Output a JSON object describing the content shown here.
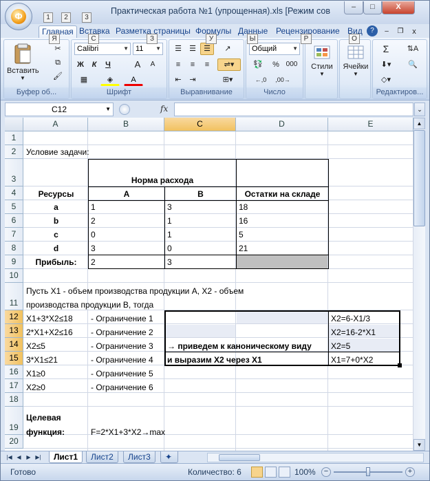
{
  "title_bar": {
    "title": "Практическая работа №1 (упрощенная).xls  [Режим сов",
    "office_key": "Ф",
    "qat_keys": [
      "1",
      "2",
      "3"
    ],
    "min_label": "–",
    "max_label": "□",
    "close_label": "X"
  },
  "ribbon_tabs": [
    {
      "label": "Главная",
      "key": "Я"
    },
    {
      "label": "Вставка",
      "key": "С"
    },
    {
      "label": "Разметка страницы",
      "key": "З"
    },
    {
      "label": "Формулы",
      "key": "У"
    },
    {
      "label": "Данные",
      "key": "Ы"
    },
    {
      "label": "Рецензирование",
      "key": "Р"
    },
    {
      "label": "Вид",
      "key": "О"
    }
  ],
  "ribbon": {
    "clipboard": {
      "paste_label": "Вставить",
      "group_label": "Буфер об..."
    },
    "font": {
      "name": "Calibri",
      "size": "11",
      "group_label": "Шрифт",
      "bold": "Ж",
      "italic": "К",
      "underline": "Ч",
      "grow": "A",
      "shrink": "A"
    },
    "alignment": {
      "group_label": "Выравнивание"
    },
    "number": {
      "format": "Общий",
      "percent": "%",
      "thousands": "000",
      "group_label": "Число"
    },
    "styles": {
      "label": "Стили"
    },
    "cells": {
      "label": "Ячейки"
    },
    "editing": {
      "sum": "Σ",
      "group_label": "Редактиров..."
    }
  },
  "formula_bar": {
    "name_box": "C12",
    "fx": "fx",
    "value": ""
  },
  "columns": [
    "A",
    "B",
    "C",
    "D",
    "E"
  ],
  "rows": [
    "1",
    "2",
    "3",
    "4",
    "5",
    "6",
    "7",
    "8",
    "9",
    "10",
    "11",
    "12",
    "13",
    "14",
    "15",
    "16",
    "17",
    "18",
    "19",
    "20"
  ],
  "cells": {
    "task": "Условие задачи:",
    "norm_header": "Норма расхода",
    "resources_header": "Ресурсы",
    "col_a_header": "А",
    "col_b_header": "В",
    "stock_header": "Остатки на складе",
    "r5": [
      "a",
      "1",
      "3",
      "18"
    ],
    "r6": [
      "b",
      "2",
      "1",
      "16"
    ],
    "r7": [
      "c",
      "0",
      "1",
      "5"
    ],
    "r8": [
      "d",
      "3",
      "0",
      "21"
    ],
    "r9": [
      "Прибыль:",
      "2",
      "3"
    ],
    "r11_line1": "Пусть Х1 - объем производства продукции А, Х2 - объем",
    "r11_line2": "производства продукции В, тогда",
    "constraints": [
      {
        "expr": "Х1+3*Х2≤18",
        "label": "- Ограничение 1"
      },
      {
        "expr": "2*Х1+Х2≤16",
        "label": "- Ограничение 2"
      },
      {
        "expr": "Х2≤5",
        "label": "- Ограничение 3"
      },
      {
        "expr": "3*Х1≤21",
        "label": "- Ограничение 4"
      },
      {
        "expr": "Х1≥0",
        "label": "- Ограничение 5"
      },
      {
        "expr": "Х2≥0",
        "label": "- Ограничение 6"
      }
    ],
    "canonical_line1": "→ приведем к каноническому виду",
    "canonical_line2": "и выразим Х2 через Х1",
    "e_values": [
      "Х2=6-Х1/3",
      "Х2=16-2*Х1",
      "Х2=5",
      "Х1=7+0*Х2"
    ],
    "target_line1": "Целевая",
    "target_line2": "функция:",
    "target_formula": "F=2*X1+3*X2→max"
  },
  "sheets": [
    "Лист1",
    "Лист2",
    "Лист3"
  ],
  "status": {
    "ready": "Готово",
    "count": "Количество: 6",
    "zoom": "100%",
    "zoom_level": 0.5
  }
}
